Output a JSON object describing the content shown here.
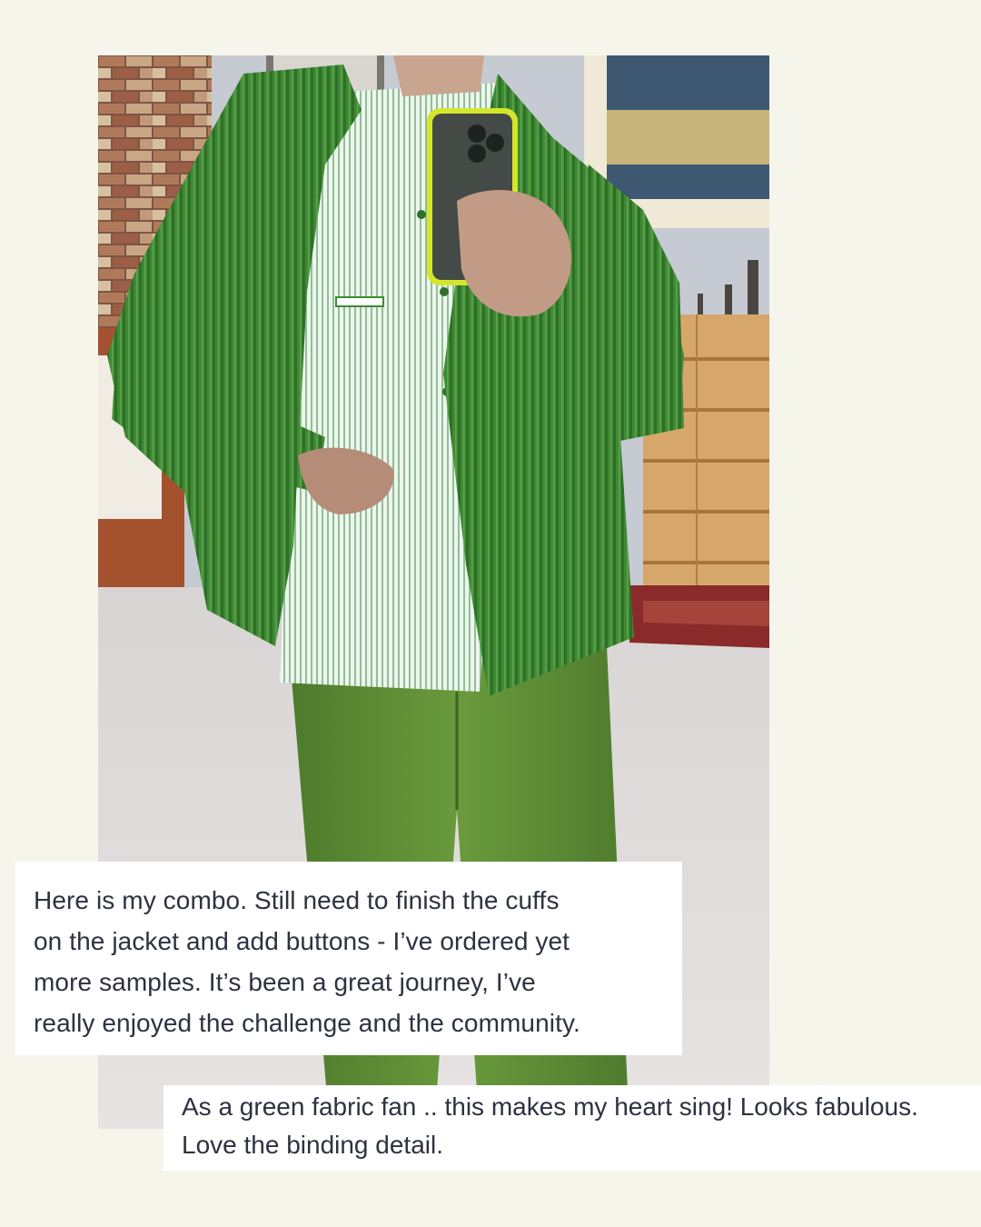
{
  "photo": {
    "subject": "person in green corduroy jacket, striped shirt and green trousers taking a mirror selfie",
    "colors": {
      "background": "#f6f5ec",
      "jacket": "#3f8a34",
      "shirt": "#dfeee3",
      "trousers": "#5e8a34",
      "phone_case": "#d4e62c",
      "floor": "#dcd9d8",
      "dresser": "#d9a86c",
      "rug": "#8a2a2a",
      "brick": "#a86a4c",
      "wall": "#c8ccd4"
    }
  },
  "comments": [
    {
      "lines": [
        "Here is my combo. Still need to finish the cuffs",
        "on the jacket and add buttons - I’ve ordered yet",
        "more samples. It’s been a great journey, I’ve",
        "really enjoyed the challenge and the community."
      ]
    },
    {
      "lines": [
        "As a green fabric fan .. this makes my heart sing! Looks fabulous.",
        "Love the binding detail."
      ]
    }
  ]
}
